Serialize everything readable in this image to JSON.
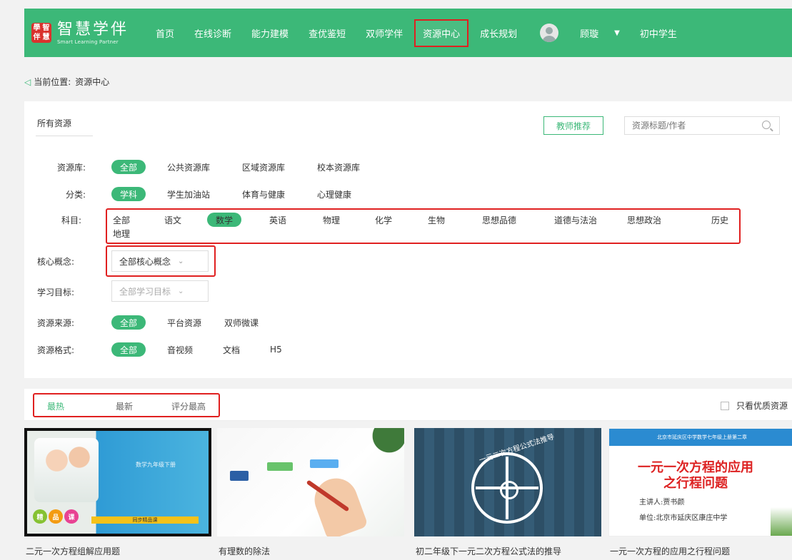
{
  "header": {
    "logo_chars": [
      "學",
      "智",
      "伴",
      "慧"
    ],
    "logo_cn": "智慧学伴",
    "logo_en": "Smart Learning Partner",
    "nav": [
      "首页",
      "在线诊断",
      "能力建模",
      "查优鉴短",
      "双师学伴",
      "资源中心",
      "成长规划"
    ],
    "active_nav": "资源中心",
    "user_name": "顾璇",
    "role": "初中学生",
    "colors": {
      "header_bg": "#3cb878",
      "highlight": "#e02020"
    }
  },
  "breadcrumb": {
    "prefix": "当前位置:",
    "current": "资源中心"
  },
  "panel": {
    "tab_all": "所有资源",
    "teacher_btn": "教师推荐",
    "search_placeholder": "资源标题/作者",
    "library": {
      "label": "资源库:",
      "selected": "全部",
      "options": [
        "公共资源库",
        "区域资源库",
        "校本资源库"
      ]
    },
    "category": {
      "label": "分类:",
      "selected": "学科",
      "options": [
        "学生加油站",
        "体育与健康",
        "心理健康"
      ]
    },
    "subject": {
      "label": "科目:",
      "items": [
        "全部",
        "语文",
        "数学",
        "英语",
        "物理",
        "化学",
        "生物",
        "思想品德",
        "道德与法治",
        "思想政治",
        "历史",
        "地理"
      ],
      "selected": "数学"
    },
    "core": {
      "label": "核心概念:",
      "value": "全部核心概念"
    },
    "goal": {
      "label": "学习目标:",
      "value": "全部学习目标"
    },
    "source": {
      "label": "资源来源:",
      "selected": "全部",
      "options": [
        "平台资源",
        "双师微课"
      ]
    },
    "format": {
      "label": "资源格式:",
      "selected": "全部",
      "options": [
        "音视频",
        "文档",
        "H5"
      ]
    }
  },
  "sort": {
    "items": [
      "最热",
      "最新",
      "评分最高"
    ],
    "active": "最热",
    "quality_label": "只看优质资源"
  },
  "cards": [
    {
      "title": "二元一次方程组解应用题",
      "thumb_text": "数学九年级下册",
      "badge": [
        "精",
        "品",
        "课"
      ],
      "strip_text": "同步精品课"
    },
    {
      "title": "有理数的除法",
      "thumb_text": ""
    },
    {
      "title": "初二年级下一元二次方程公式法的推导",
      "thumb_text": "一元二次方程公式法推导"
    },
    {
      "title": "一元一次方程的应用之行程问题",
      "thumb_band": "北京市延庆区中学数学七年级上册第二章",
      "thumb_title1": "一元一次方程的应用",
      "thumb_title2": "之行程问题",
      "speaker": "主讲人:贾书颜",
      "unit": "单位:北京市延庆区康庄中学"
    }
  ]
}
